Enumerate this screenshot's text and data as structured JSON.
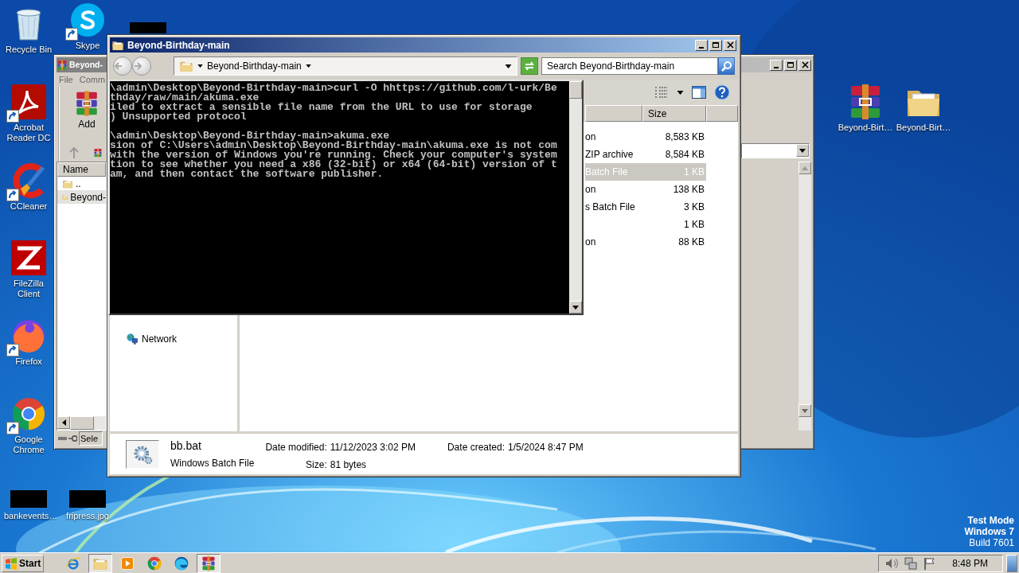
{
  "desktop": {
    "icons": [
      {
        "label": "Recycle Bin",
        "kind": "recycle",
        "shortcut": false
      },
      {
        "label": "Acrobat Reader DC",
        "kind": "acrobat",
        "shortcut": true
      },
      {
        "label": "CCleaner",
        "kind": "ccleaner",
        "shortcut": true
      },
      {
        "label": "FileZilla Client",
        "kind": "filezilla",
        "shortcut": false
      },
      {
        "label": "Firefox",
        "kind": "firefox",
        "shortcut": true
      },
      {
        "label": "Google Chrome",
        "kind": "chrome",
        "shortcut": true
      },
      {
        "label": "bankevents…",
        "kind": "thumbnail",
        "shortcut": false
      },
      {
        "label": "Skype",
        "kind": "skype",
        "shortcut": true
      },
      {
        "kind": "thumbnail",
        "shortcut": false
      },
      {
        "label": "fripress.jpg",
        "kind": "thumbnail",
        "shortcut": false
      },
      {
        "label": "Beyond-Birt…",
        "kind": "winrar",
        "shortcut": false
      },
      {
        "label": "Beyond-Birt…",
        "kind": "folder",
        "shortcut": false
      }
    ]
  },
  "archive_window": {
    "title": "Beyond-",
    "menu": [
      "File",
      "Comm"
    ],
    "toolbar": [
      {
        "label": "Add"
      }
    ],
    "list_header": "Name",
    "rows": [
      {
        "name": "..",
        "selected": false
      },
      {
        "name": "Beyond-",
        "selected": true
      }
    ],
    "status": "Sele"
  },
  "explorer_window": {
    "title": "Beyond-Birthday-main",
    "breadcrumb": "Beyond-Birthday-main",
    "search": {
      "placeholder": "Search Beyond-Birthday-main"
    },
    "columns": [
      "Size"
    ],
    "rows": [
      {
        "type": "on",
        "size": "8,583 KB",
        "selected": false
      },
      {
        "type": "ZIP archive",
        "size": "8,584 KB",
        "selected": false
      },
      {
        "type": "Batch File",
        "size": "1 KB",
        "selected": true
      },
      {
        "type": "on",
        "size": "138 KB",
        "selected": false
      },
      {
        "type": "s Batch File",
        "size": "3 KB",
        "selected": false
      },
      {
        "size": "1 KB",
        "selected": false
      },
      {
        "type": "on",
        "size": "88 KB",
        "selected": false
      }
    ],
    "nav": [
      {
        "label": "Network"
      }
    ],
    "details": {
      "name": "bb.bat",
      "type": "Windows Batch File",
      "fields": [
        {
          "label": "Date modified:",
          "value": "11/12/2023 3:02 PM"
        },
        {
          "label": "Date created:",
          "value": "1/5/2024 8:47 PM"
        },
        {
          "label": "Size:",
          "value": "81 bytes"
        }
      ]
    }
  },
  "console_window": {
    "blocks": [
      [
        "\\admin\\Desktop\\Beyond-Birthday-main>curl -O hhttps://github.com/l-urk/Be",
        "thday/raw/main/akuma.exe",
        "iled to extract a sensible file name from the URL to use for storage",
        ") Unsupported protocol"
      ],
      [
        "\\admin\\Desktop\\Beyond-Birthday-main>akuma.exe",
        "sion of C:\\Users\\admin\\Desktop\\Beyond-Birthday-main\\akuma.exe is not com",
        "with the version of Windows you're running. Check your computer's system",
        "tion to see whether you need a x86 (32-bit) or x64 (64-bit) version of t",
        "am, and then contact the software publisher."
      ]
    ]
  },
  "taskbar": {
    "start": "Start",
    "apps": [
      {
        "kind": "ie",
        "active": false
      },
      {
        "kind": "folder",
        "active": true
      },
      {
        "kind": "media",
        "active": false
      },
      {
        "kind": "chrome",
        "active": false
      },
      {
        "kind": "edge",
        "active": false
      },
      {
        "kind": "winrar",
        "active": true
      }
    ],
    "clock": "8:48 PM"
  },
  "system_notice": [
    {
      "text": "Test Mode",
      "bold": true
    },
    {
      "text": "Windows 7",
      "bold": true
    },
    {
      "text": "Build 7601",
      "bold": false
    }
  ]
}
